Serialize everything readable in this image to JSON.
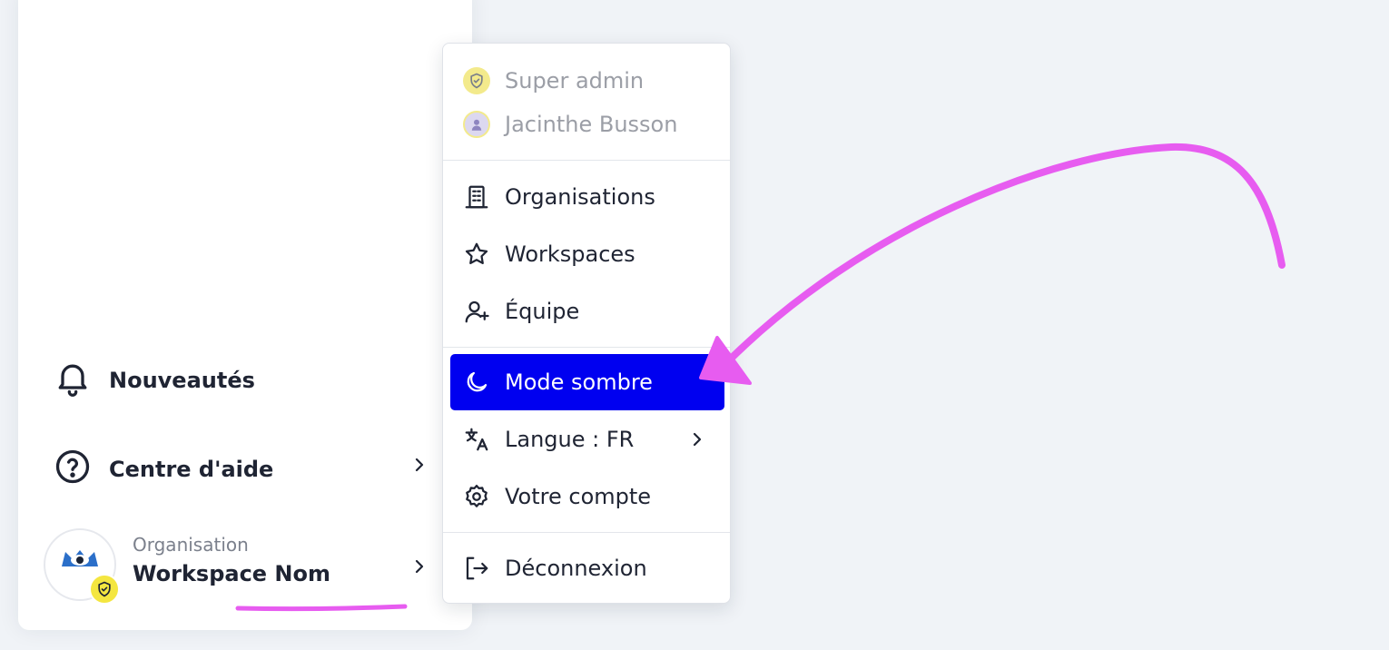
{
  "sidebar": {
    "news_label": "Nouveautés",
    "help_label": "Centre d'aide",
    "org_caption": "Organisation",
    "workspace_name": "Workspace Nom"
  },
  "menu": {
    "role_label": "Super admin",
    "user_name": "Jacinthe Busson",
    "organisations_label": "Organisations",
    "workspaces_label": "Workspaces",
    "team_label": "Équipe",
    "dark_mode_label": "Mode sombre",
    "language_label": "Langue : FR",
    "account_label": "Votre compte",
    "logout_label": "Déconnexion"
  },
  "colors": {
    "active_bg": "#0000f0",
    "annotation": "#e75cf0",
    "badge": "#f4e640"
  },
  "icons": {
    "news": "bell-icon",
    "help": "question-circle-icon",
    "role": "shield-check-icon",
    "organisations": "building-icon",
    "workspaces": "star-icon",
    "team": "user-plus-icon",
    "dark_mode": "moon-icon",
    "language": "translate-icon",
    "account": "gear-icon",
    "logout": "logout-icon"
  }
}
